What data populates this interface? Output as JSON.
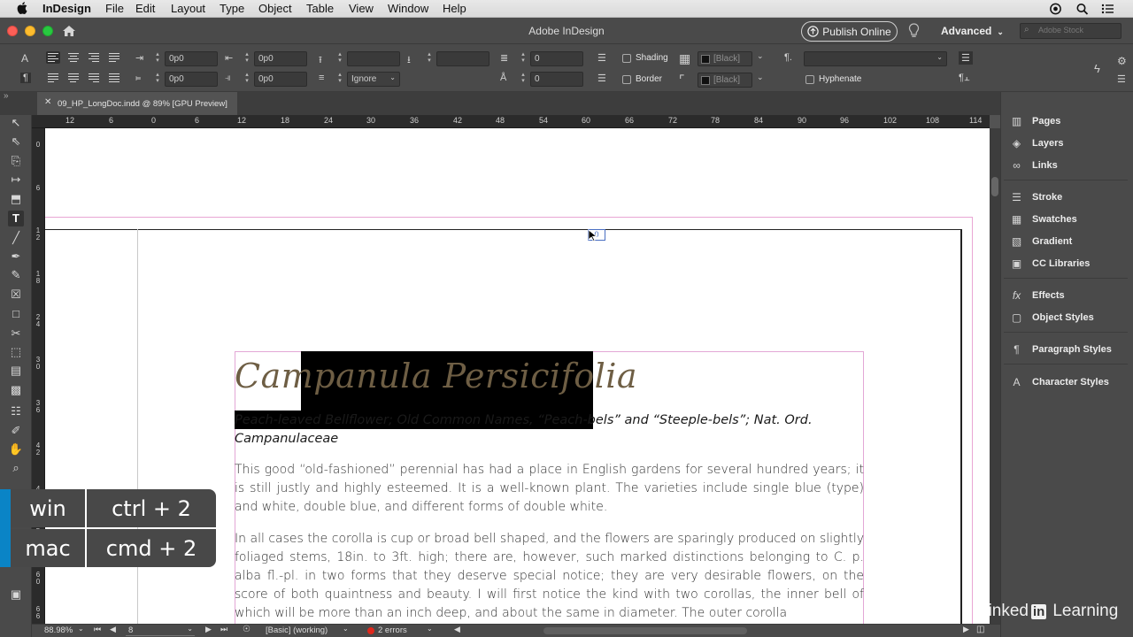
{
  "menubar": {
    "items": [
      "InDesign",
      "File",
      "Edit",
      "Layout",
      "Type",
      "Object",
      "Table",
      "View",
      "Window",
      "Help"
    ]
  },
  "titlebar": {
    "title": "Adobe InDesign",
    "publish_label": "Publish Online",
    "workspace_label": "Advanced",
    "stock_placeholder": "Adobe Stock"
  },
  "controlpanel": {
    "left_indent": "0p0",
    "right_indent": "0p0",
    "first_line_indent": "0p0",
    "last_line_indent": "0p0",
    "align_to_grid": "Ignore",
    "drop_cap_lines": "0",
    "drop_cap_chars": "0",
    "shading_label": "Shading",
    "border_label": "Border",
    "shading_swatch": "[Black]",
    "border_swatch": "[Black]",
    "hyphenate_label": "Hyphenate"
  },
  "document": {
    "tab_label": "09_HP_LongDoc.indd @ 89% [GPU Preview]"
  },
  "rulers": {
    "h_ticks": [
      "12",
      "6",
      "0",
      "6",
      "12",
      "18",
      "24",
      "30",
      "36",
      "42",
      "48",
      "54",
      "60",
      "66",
      "72",
      "78",
      "84",
      "90",
      "96",
      "102",
      "108",
      "114"
    ],
    "v_ticks": [
      "0",
      "6",
      "1\n2",
      "1\n8",
      "2\n4",
      "3\n0",
      "3\n6",
      "4\n2",
      "4\n8",
      "5\n4",
      "6\n0",
      "6\n6",
      "7\n2"
    ]
  },
  "page": {
    "headline": "Campanula Persicifolia",
    "subtitle": "Peach-leaved Bellflower; Old Common Names, “Peach-bels” and “Steeple-bels”; Nat. Ord. Campanulaceae",
    "paragraph_1": "This good “old-fashioned” perennial has had a place in English gardens for several hundred years; it is still justly and highly esteemed. It is a well-known plant. The varieties include single blue (type) and white, double blue, and different forms of double white.",
    "paragraph_2": "In all cases the corolla is cup or broad bell shaped, and the flowers are sparingly produced on slightly foliaged stems, 18in. to 3ft. high; there are, however, such marked distinctions belonging to C. p. alba fl.-pl. in two forms that they deserve special notice; they are very desirable flowers, on the score of both quaintness and beauty. I will first notice the kind with two corollas, the inner bell of which will be more than an inch deep, and about the same in diameter. The outer corolla"
  },
  "panels": {
    "items": [
      {
        "label": "Pages",
        "icon": "pages-icon"
      },
      {
        "label": "Layers",
        "icon": "layers-icon"
      },
      {
        "label": "Links",
        "icon": "links-icon"
      },
      {
        "label": "Stroke",
        "icon": "stroke-icon"
      },
      {
        "label": "Swatches",
        "icon": "swatches-icon"
      },
      {
        "label": "Gradient",
        "icon": "gradient-icon"
      },
      {
        "label": "CC Libraries",
        "icon": "cc-libraries-icon"
      },
      {
        "label": "Effects",
        "icon": "effects-icon"
      },
      {
        "label": "Object Styles",
        "icon": "object-styles-icon"
      },
      {
        "label": "Paragraph Styles",
        "icon": "paragraph-styles-icon"
      },
      {
        "label": "Character Styles",
        "icon": "character-styles-icon"
      }
    ]
  },
  "statusbar": {
    "zoom": "88.98%",
    "page_number": "8",
    "profile": "[Basic] (working)",
    "errors": "2 errors"
  },
  "overlay": {
    "win_label": "win",
    "win_shortcut": "ctrl + 2",
    "mac_label": "mac",
    "mac_shortcut": "cmd + 2",
    "accent": "#0a84c6"
  },
  "watermark": {
    "brand_left": "Linked",
    "brand_box": "in",
    "brand_right": "Learning"
  }
}
